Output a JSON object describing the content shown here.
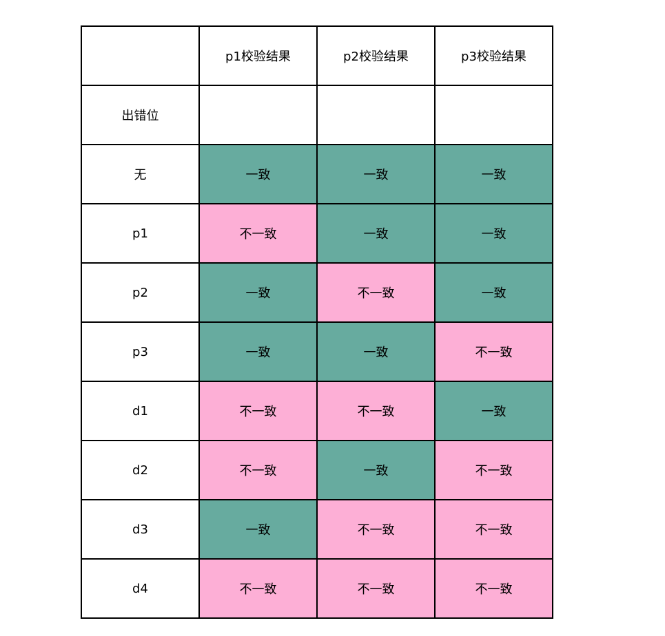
{
  "colors": {
    "consistent": "#67ab9f",
    "inconsistent": "#fdafd6",
    "neutral": "#ffffff",
    "border": "#000000"
  },
  "table": {
    "corner": "",
    "columns": [
      "p1校验结果",
      "p2校验结果",
      "p3校验结果"
    ],
    "rows": [
      {
        "label": "出错位",
        "cells": [
          "",
          "",
          ""
        ],
        "status": [
          "none",
          "none",
          "none"
        ]
      },
      {
        "label": "无",
        "cells": [
          "一致",
          "一致",
          "一致"
        ],
        "status": [
          "ok",
          "ok",
          "ok"
        ]
      },
      {
        "label": "p1",
        "cells": [
          "不一致",
          "一致",
          "一致"
        ],
        "status": [
          "bad",
          "ok",
          "ok"
        ]
      },
      {
        "label": "p2",
        "cells": [
          "一致",
          "不一致",
          "一致"
        ],
        "status": [
          "ok",
          "bad",
          "ok"
        ]
      },
      {
        "label": "p3",
        "cells": [
          "一致",
          "一致",
          "不一致"
        ],
        "status": [
          "ok",
          "ok",
          "bad"
        ]
      },
      {
        "label": "d1",
        "cells": [
          "不一致",
          "不一致",
          "一致"
        ],
        "status": [
          "bad",
          "bad",
          "ok"
        ]
      },
      {
        "label": "d2",
        "cells": [
          "不一致",
          "一致",
          "不一致"
        ],
        "status": [
          "bad",
          "ok",
          "bad"
        ]
      },
      {
        "label": "d3",
        "cells": [
          "一致",
          "不一致",
          "不一致"
        ],
        "status": [
          "ok",
          "bad",
          "bad"
        ]
      },
      {
        "label": "d4",
        "cells": [
          "不一致",
          "不一致",
          "不一致"
        ],
        "status": [
          "bad",
          "bad",
          "bad"
        ]
      }
    ]
  }
}
